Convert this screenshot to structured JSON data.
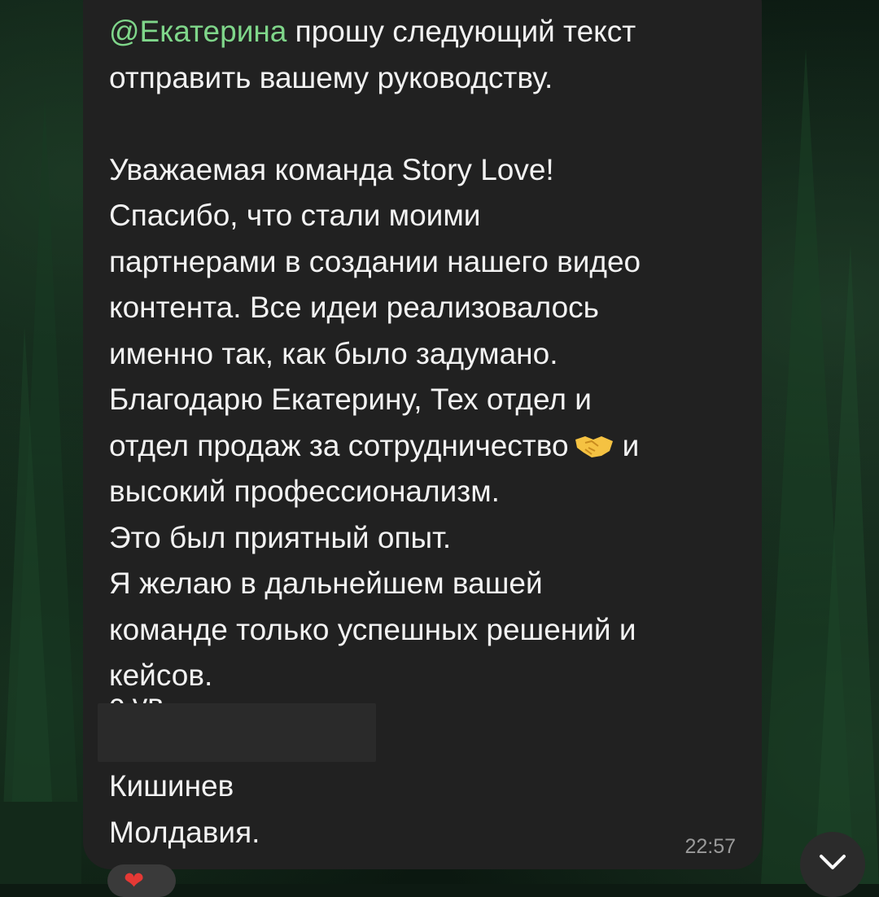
{
  "message": {
    "mention": "@Екатерина",
    "first_line_rest": " прошу следующий текст",
    "line2": "отправить вашему руководству.",
    "line3": "",
    "line4": "Уважаемая команда Story Love!",
    "line5": "Спасибо, что стали моими",
    "line6": "партнерами в создании нашего видео",
    "line7": "контента. Все идеи реализовалось",
    "line8": "именно так, как было задумано.",
    "line9": "Благодарю Екатерину, Тех отдел и",
    "line10_a": "отдел продаж за сотрудничество",
    "line10_b": "и",
    "line11": "высокий профессионализм.",
    "line12": "Это был приятный опыт.",
    "line13": "Я желаю в дальнейшем вашей",
    "line14": "команде только успешных решений и",
    "line15": "кейсов.",
    "signoff_partial": "с ув.",
    "city": "Кишинев",
    "country": "Молдавия.",
    "time": "22:57"
  },
  "icons": {
    "emoji": "handshake-emoji",
    "scroll": "chevron-down-icon",
    "reaction": "heart-icon"
  },
  "colors": {
    "bubble": "#212121",
    "mention": "#7fd68a",
    "text": "#f2f2f2",
    "time": "#9a9a9a"
  },
  "reaction": {
    "symbol": "❤"
  }
}
